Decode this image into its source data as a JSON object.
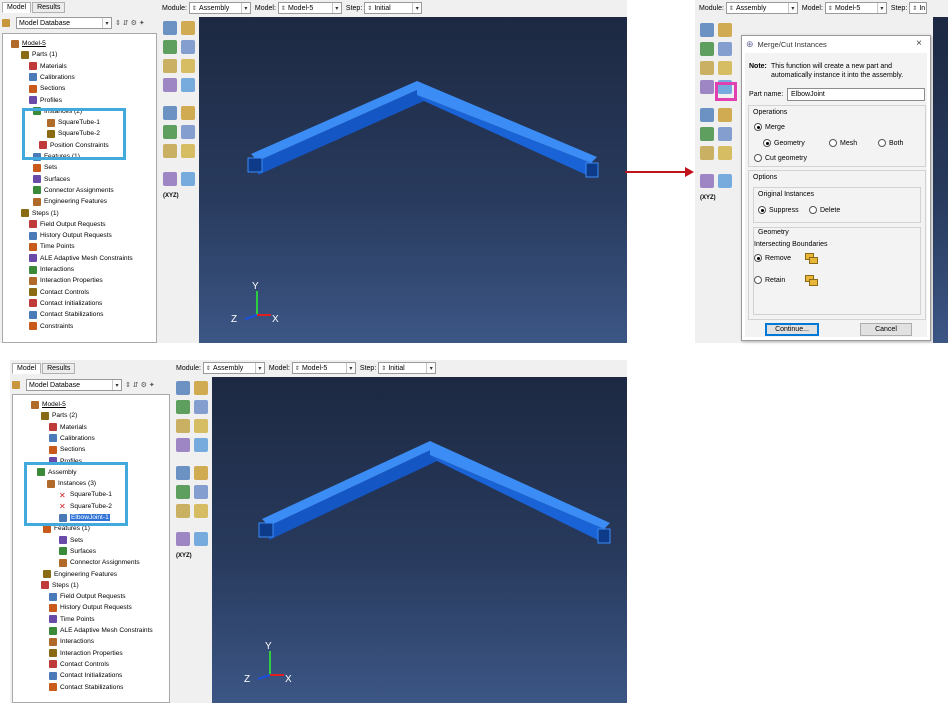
{
  "context_bar": {
    "module_label": "Module:",
    "module_value": "Assembly",
    "model_label": "Model:",
    "model_value": "Model-5",
    "step_label": "Step:",
    "step_value": "Initial",
    "step_value_truncated": "In"
  },
  "tabs": [
    "Model",
    "Results"
  ],
  "database": "Model Database",
  "tree_top": {
    "rows": [
      "Model-5",
      "Parts (1)",
      "Materials",
      "Calibrations",
      "Sections",
      "Profiles",
      "Instances (2)",
      "SquareTube-1",
      "SquareTube-2",
      "Position Constraints",
      "Features (1)",
      "Sets",
      "Surfaces",
      "Connector Assignments",
      "Engineering Features",
      "Steps (1)",
      "Field Output Requests",
      "History Output Requests",
      "Time Points",
      "ALE Adaptive Mesh Constraints",
      "Interactions",
      "Interaction Properties",
      "Contact Controls",
      "Contact Initializations",
      "Contact Stabilizations",
      "Constraints"
    ]
  },
  "tree_bottom": {
    "rows": [
      "Model-5",
      "Parts (2)",
      "Materials",
      "Calibrations",
      "Sections",
      "Profiles",
      "Assembly",
      "Instances (3)",
      "SquareTube-1",
      "SquareTube-2",
      "ElbowJoint-1",
      "Features (1)",
      "Sets",
      "Surfaces",
      "Connector Assignments",
      "Engineering Features",
      "Steps (1)",
      "Field Output Requests",
      "History Output Requests",
      "Time Points",
      "ALE Adaptive Mesh Constraints",
      "Interactions",
      "Interaction Properties",
      "Contact Controls",
      "Contact Initializations",
      "Contact Stabilizations"
    ]
  },
  "triad": {
    "y": "Y",
    "z": "Z",
    "x": "X"
  },
  "toolbox_xyz": "(XYZ)",
  "dialog": {
    "title": "Merge/Cut Instances",
    "note_label": "Note:",
    "note_text_1": "This function will create a new part and",
    "note_text_2": "automatically instance it into the assembly.",
    "part_name_label": "Part name:",
    "part_name_value": "ElbowJoint",
    "operations_label": "Operations",
    "merge": "Merge",
    "geometry": "Geometry",
    "mesh": "Mesh",
    "both": "Both",
    "cut_geometry": "Cut geometry",
    "options_label": "Options",
    "original_instances": "Original Instances",
    "suppress": "Suppress",
    "delete": "Delete",
    "geometry_group": "Geometry",
    "intersecting_boundaries": "Intersecting Boundaries",
    "remove": "Remove",
    "retain": "Retain",
    "continue": "Continue...",
    "cancel": "Cancel",
    "close": "×"
  },
  "colors": {
    "highlight_blue": "#42a9dc",
    "highlight_magenta": "#e040b0",
    "arrow_red": "#c0141c",
    "beam_blue": "#1f6fe0"
  }
}
